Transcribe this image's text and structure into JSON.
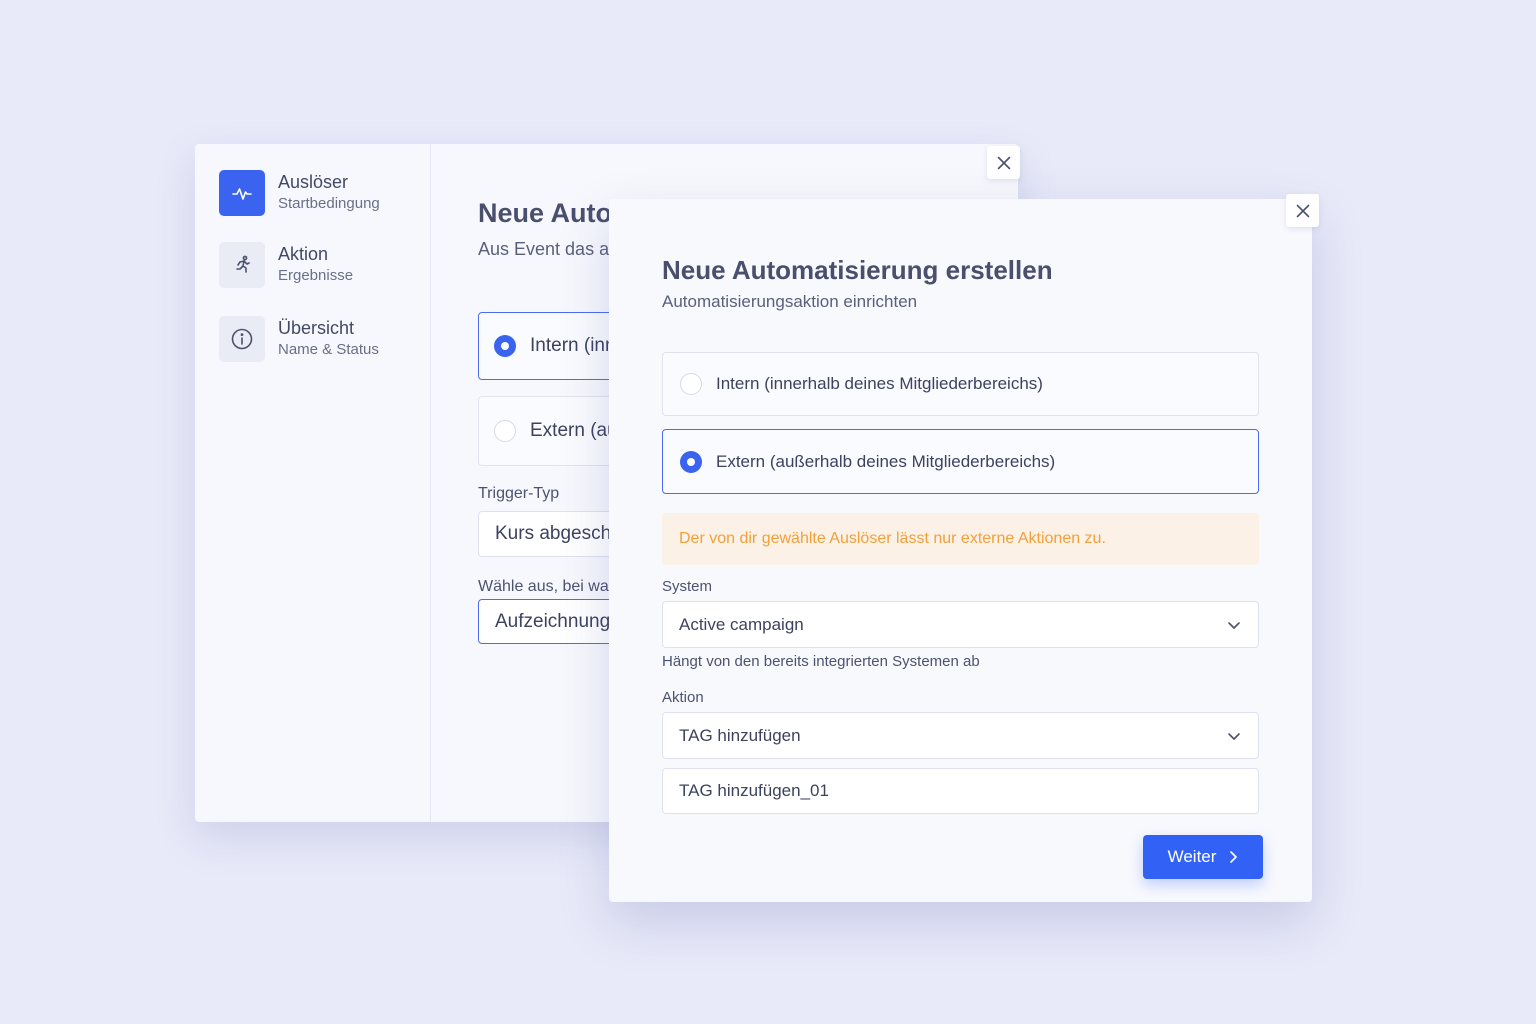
{
  "colors": {
    "accent": "#3262f5",
    "warning_text": "#f2a03a",
    "warning_bg": "#fbf1e6",
    "background": "#e8eaf9"
  },
  "steps": [
    {
      "title": "Auslöser",
      "subtitle": "Startbedingung",
      "icon": "pulse-icon",
      "active": true
    },
    {
      "title": "Aktion",
      "subtitle": "Ergebnisse",
      "icon": "running-person-icon",
      "active": false
    },
    {
      "title": "Übersicht",
      "subtitle": "Name & Status",
      "icon": "info-icon",
      "active": false
    }
  ],
  "back_modal": {
    "title": "Neue Auto",
    "subtitle": "Aus Event das a",
    "options": [
      {
        "label": "Intern (inn",
        "selected": true
      },
      {
        "label": "Extern (au",
        "selected": false
      }
    ],
    "trigger_label": "Trigger-Typ",
    "trigger_value": "Kurs abgeschl",
    "choose_label": "Wähle aus, bei wa",
    "choose_value": "Aufzeichnung"
  },
  "front_modal": {
    "title": "Neue Automatisierung erstellen",
    "subtitle": "Automatisierungsaktion einrichten",
    "options": [
      {
        "label": "Intern (innerhalb deines Mitgliederbereichs)",
        "selected": false
      },
      {
        "label": "Extern (außerhalb deines Mitgliederbereichs)",
        "selected": true
      }
    ],
    "warning": "Der von dir gewählte Auslöser lässt nur externe Aktionen zu.",
    "system_label": "System",
    "system_value": "Active campaign",
    "system_hint": "Hängt von den bereits integrierten Systemen ab",
    "action_label": "Aktion",
    "action_value": "TAG hinzufügen",
    "tag_name_value": "TAG hinzufügen_01",
    "next_button": "Weiter"
  }
}
